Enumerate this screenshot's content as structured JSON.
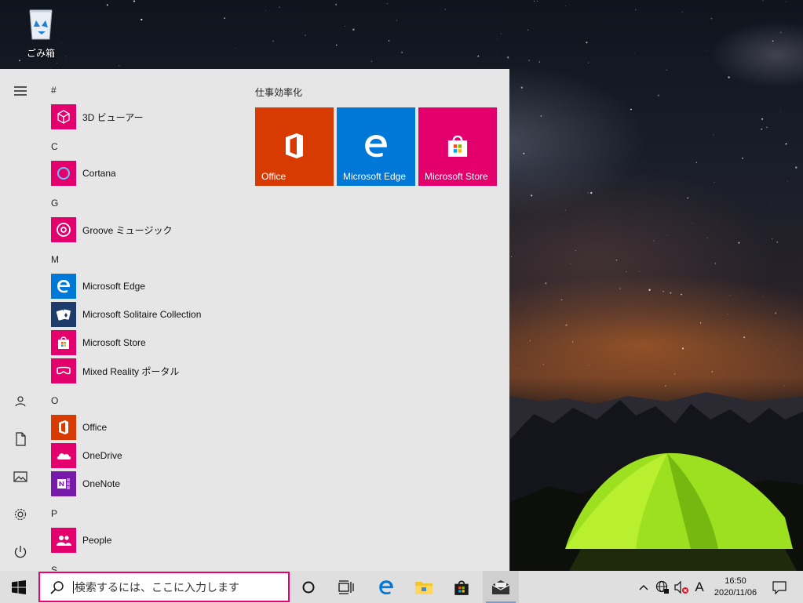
{
  "desktop": {
    "recycle_bin_label": "ごみ箱"
  },
  "start_menu": {
    "rail": [
      {
        "name": "expand",
        "icon": "hamburger-icon"
      },
      {
        "name": "user",
        "icon": "user-icon"
      },
      {
        "name": "documents",
        "icon": "document-icon"
      },
      {
        "name": "pictures",
        "icon": "pictures-icon"
      },
      {
        "name": "settings",
        "icon": "gear-icon"
      },
      {
        "name": "power",
        "icon": "power-icon"
      }
    ],
    "app_list": {
      "letters": [
        "#",
        "C",
        "G",
        "M",
        "O",
        "P",
        "S"
      ],
      "apps": [
        {
          "label": "3D ビューアー",
          "icon": "cube-icon",
          "color": "#e3006d"
        },
        {
          "label": "Cortana",
          "icon": "cortana-ring-icon",
          "color": "#e3006d"
        },
        {
          "label": "Groove ミュージック",
          "icon": "groove-music-icon",
          "color": "#e3006d"
        },
        {
          "label": "Microsoft Edge",
          "icon": "edge-icon",
          "color": "#0078d7"
        },
        {
          "label": "Microsoft Solitaire Collection",
          "icon": "cards-icon",
          "color": "#1d3b6b"
        },
        {
          "label": "Microsoft Store",
          "icon": "store-bag-icon",
          "color": "#e3006d"
        },
        {
          "label": "Mixed Reality ポータル",
          "icon": "mixed-reality-icon",
          "color": "#e3006d"
        },
        {
          "label": "Office",
          "icon": "office-icon",
          "color": "#d83b01"
        },
        {
          "label": "OneDrive",
          "icon": "onedrive-cloud-icon",
          "color": "#e3006d"
        },
        {
          "label": "OneNote",
          "icon": "onenote-icon",
          "color": "#7719aa"
        },
        {
          "label": "People",
          "icon": "people-icon",
          "color": "#e3006d"
        }
      ]
    },
    "tiles": {
      "group_title": "仕事効率化",
      "items": [
        {
          "label": "Office",
          "icon": "office-icon",
          "color": "#d83b01"
        },
        {
          "label": "Microsoft Edge",
          "icon": "edge-icon",
          "color": "#0078d7"
        },
        {
          "label": "Microsoft Store",
          "icon": "store-bag-icon",
          "color": "#e3006d"
        }
      ]
    }
  },
  "taskbar": {
    "search_placeholder": "検索するには、ここに入力します",
    "pinned": [
      {
        "name": "cortana",
        "icon": "cortana-circle-icon"
      },
      {
        "name": "task-view",
        "icon": "task-view-icon"
      },
      {
        "name": "edge",
        "icon": "edge-icon"
      },
      {
        "name": "file-explorer",
        "icon": "folder-icon"
      },
      {
        "name": "store",
        "icon": "store-bag-icon"
      },
      {
        "name": "mail",
        "icon": "mail-icon"
      }
    ],
    "tray": {
      "ime_mode": "A",
      "time": "16:50",
      "date": "2020/11/06"
    }
  }
}
